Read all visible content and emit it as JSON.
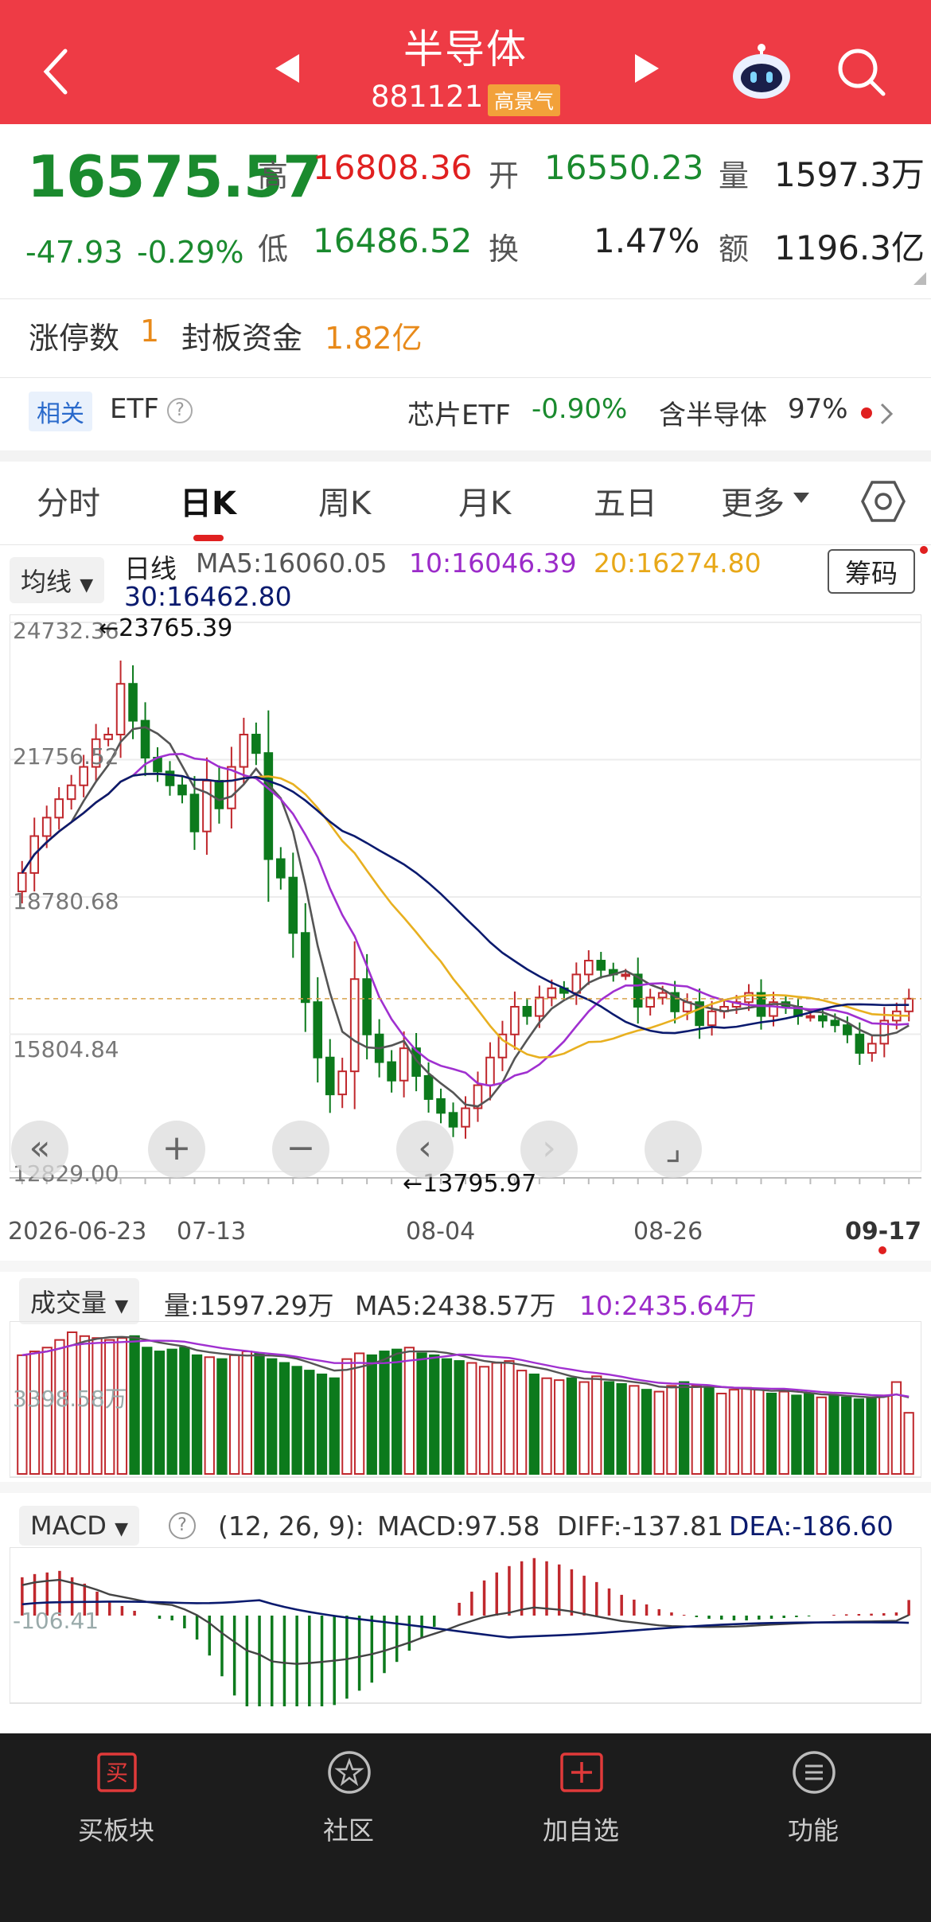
{
  "header": {
    "title": "半导体",
    "code": "881121",
    "badge": "高景气"
  },
  "quote": {
    "price": "16575.57",
    "change": "-47.93",
    "change_pct": "-0.29%",
    "high_label": "高",
    "high": "16808.36",
    "open_label": "开",
    "open": "16550.23",
    "vol_label": "量",
    "vol": "1597.3万",
    "low_label": "低",
    "low": "16486.52",
    "turn_label": "换",
    "turn": "1.47%",
    "amt_label": "额",
    "amt": "1196.3亿"
  },
  "limit": {
    "count_label": "涨停数",
    "count": "1",
    "fund_label": "封板资金",
    "fund": "1.82亿"
  },
  "etf": {
    "tag": "相关",
    "label": "ETF",
    "q": "?",
    "name": "芯片ETF",
    "pct": "-0.90%",
    "contain_label": "含半导体",
    "contain": "97%"
  },
  "tabs": [
    "分时",
    "日K",
    "周K",
    "月K",
    "五日",
    "更多"
  ],
  "kline": {
    "selector": "均线",
    "chips": "筹码",
    "name": "日线",
    "ma5": "MA5:16060.05",
    "ma10": "10:16046.39",
    "ma20": "20:16274.80",
    "ma30": "30:16462.80",
    "y_ticks": [
      "24732.36",
      "21756.52",
      "18780.68",
      "15804.84",
      "12829.00"
    ],
    "high_mark": "←23765.39",
    "low_mark": "←13795.97",
    "x_ticks": [
      "2026-06-23",
      "07-13",
      "08-04",
      "08-26",
      "09-17"
    ]
  },
  "volume": {
    "selector": "成交量",
    "vol": "量:1597.29万",
    "ma5": "MA5:2438.57万",
    "ma10": "10:2435.64万",
    "y_tick": "3398.58万"
  },
  "macd": {
    "selector": "MACD",
    "q": "?",
    "params": "(12, 26, 9):",
    "macd": "MACD:97.58",
    "diff": "DIFF:-137.81",
    "dea": "DEA:-186.60",
    "y_tick": "-106.41"
  },
  "colors": {
    "up": "#c0282d",
    "down": "#0c7a1c",
    "ma5": "#555555",
    "ma10": "#a030d0",
    "ma20": "#e8b020",
    "ma30": "#0a1a6e",
    "header": "#ee3b45"
  },
  "footer": [
    {
      "label": "买板块",
      "icon": "buy-icon"
    },
    {
      "label": "社区",
      "icon": "community-icon"
    },
    {
      "label": "加自选",
      "icon": "add-watch-icon"
    },
    {
      "label": "功能",
      "icon": "menu-icon"
    }
  ],
  "chart_data": {
    "type": "candlestick",
    "ylim": [
      12829.0,
      24732.36
    ],
    "close": [
      19300,
      20100,
      20500,
      20900,
      21200,
      21600,
      22200,
      22300,
      23400,
      22600,
      21800,
      21500,
      21200,
      21000,
      20200,
      21300,
      20700,
      21600,
      22300,
      21900,
      19600,
      19200,
      18000,
      16500,
      15300,
      14500,
      15000,
      17000,
      15800,
      15200,
      14800,
      15500,
      14900,
      14400,
      14100,
      13800,
      14200,
      14700,
      15300,
      15800,
      16400,
      16200,
      16600,
      16800,
      16700,
      17100,
      17400,
      17200,
      17100,
      17100,
      16400,
      16600,
      16700,
      16300,
      16500,
      16000,
      16300,
      16400,
      16500,
      16700,
      16200,
      16500,
      16400,
      16200,
      16200,
      16100,
      16000,
      15800,
      15400,
      15600,
      16100,
      16300,
      16575
    ],
    "volume": [
      3100,
      3200,
      3300,
      3500,
      3700,
      3600,
      3550,
      3500,
      3550,
      3600,
      3300,
      3200,
      3250,
      3300,
      3100,
      3050,
      3000,
      3100,
      3200,
      3150,
      3000,
      2900,
      2800,
      2700,
      2600,
      2500,
      3000,
      3150,
      3100,
      3200,
      3250,
      3300,
      3150,
      3100,
      3000,
      2950,
      2900,
      2800,
      2900,
      2950,
      2700,
      2600,
      2500,
      2450,
      2500,
      2400,
      2550,
      2400,
      2350,
      2300,
      2200,
      2150,
      2300,
      2400,
      2300,
      2250,
      2100,
      2200,
      2250,
      2200,
      2100,
      2150,
      2050,
      2100,
      2000,
      2050,
      2000,
      1950,
      2000,
      2050,
      2400,
      1597
    ],
    "ma5_vol": "2438.57万",
    "ma10_vol": "2435.64万",
    "macd_hist": [
      240,
      260,
      270,
      280,
      240,
      200,
      150,
      90,
      60,
      30,
      0,
      -20,
      -30,
      -80,
      -150,
      -250,
      -380,
      -500,
      -620,
      -680,
      -720,
      -700,
      -680,
      -640,
      -600,
      -560,
      -520,
      -470,
      -420,
      -360,
      -290,
      -220,
      -140,
      -70,
      0,
      80,
      150,
      220,
      270,
      310,
      340,
      360,
      340,
      320,
      290,
      250,
      210,
      170,
      130,
      100,
      70,
      40,
      20,
      5,
      -10,
      -20,
      -25,
      -30,
      -30,
      -25,
      -20,
      -15,
      -10,
      -5,
      0,
      5,
      8,
      10,
      12,
      15,
      20,
      97.58
    ],
    "diff": "-137.81",
    "dea": "-186.60"
  }
}
